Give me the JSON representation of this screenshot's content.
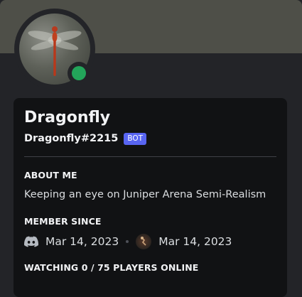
{
  "profile": {
    "display_name": "Dragonfly",
    "username": "Dragonfly#2215",
    "badge": "BOT",
    "status": "online",
    "status_color": "#23a55a",
    "avatar_icon": "dragonfly-avatar"
  },
  "about": {
    "title": "ABOUT ME",
    "text": "Keeping an eye on Juniper Arena Semi-Realism"
  },
  "member_since": {
    "title": "MEMBER SINCE",
    "discord_icon": "discord-icon",
    "discord_date": "Mar 14, 2023",
    "server_icon": "server-icon",
    "server_date": "Mar 14, 2023"
  },
  "activity": {
    "title": "WATCHING 0 / 75 PLAYERS ONLINE"
  },
  "colors": {
    "background": "#232428",
    "card": "#111214",
    "banner": "#4e4f48",
    "badge": "#5865f2"
  }
}
